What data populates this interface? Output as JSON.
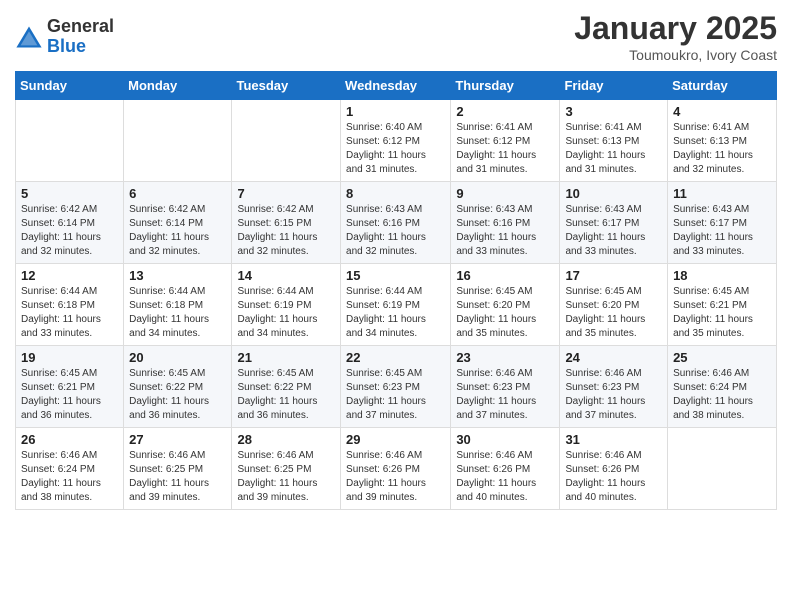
{
  "logo": {
    "general": "General",
    "blue": "Blue"
  },
  "title": {
    "month_year": "January 2025",
    "location": "Toumoukro, Ivory Coast"
  },
  "days_of_week": [
    "Sunday",
    "Monday",
    "Tuesday",
    "Wednesday",
    "Thursday",
    "Friday",
    "Saturday"
  ],
  "weeks": [
    [
      {
        "day": "",
        "info": ""
      },
      {
        "day": "",
        "info": ""
      },
      {
        "day": "",
        "info": ""
      },
      {
        "day": "1",
        "info": "Sunrise: 6:40 AM\nSunset: 6:12 PM\nDaylight: 11 hours and 31 minutes."
      },
      {
        "day": "2",
        "info": "Sunrise: 6:41 AM\nSunset: 6:12 PM\nDaylight: 11 hours and 31 minutes."
      },
      {
        "day": "3",
        "info": "Sunrise: 6:41 AM\nSunset: 6:13 PM\nDaylight: 11 hours and 31 minutes."
      },
      {
        "day": "4",
        "info": "Sunrise: 6:41 AM\nSunset: 6:13 PM\nDaylight: 11 hours and 32 minutes."
      }
    ],
    [
      {
        "day": "5",
        "info": "Sunrise: 6:42 AM\nSunset: 6:14 PM\nDaylight: 11 hours and 32 minutes."
      },
      {
        "day": "6",
        "info": "Sunrise: 6:42 AM\nSunset: 6:14 PM\nDaylight: 11 hours and 32 minutes."
      },
      {
        "day": "7",
        "info": "Sunrise: 6:42 AM\nSunset: 6:15 PM\nDaylight: 11 hours and 32 minutes."
      },
      {
        "day": "8",
        "info": "Sunrise: 6:43 AM\nSunset: 6:16 PM\nDaylight: 11 hours and 32 minutes."
      },
      {
        "day": "9",
        "info": "Sunrise: 6:43 AM\nSunset: 6:16 PM\nDaylight: 11 hours and 33 minutes."
      },
      {
        "day": "10",
        "info": "Sunrise: 6:43 AM\nSunset: 6:17 PM\nDaylight: 11 hours and 33 minutes."
      },
      {
        "day": "11",
        "info": "Sunrise: 6:43 AM\nSunset: 6:17 PM\nDaylight: 11 hours and 33 minutes."
      }
    ],
    [
      {
        "day": "12",
        "info": "Sunrise: 6:44 AM\nSunset: 6:18 PM\nDaylight: 11 hours and 33 minutes."
      },
      {
        "day": "13",
        "info": "Sunrise: 6:44 AM\nSunset: 6:18 PM\nDaylight: 11 hours and 34 minutes."
      },
      {
        "day": "14",
        "info": "Sunrise: 6:44 AM\nSunset: 6:19 PM\nDaylight: 11 hours and 34 minutes."
      },
      {
        "day": "15",
        "info": "Sunrise: 6:44 AM\nSunset: 6:19 PM\nDaylight: 11 hours and 34 minutes."
      },
      {
        "day": "16",
        "info": "Sunrise: 6:45 AM\nSunset: 6:20 PM\nDaylight: 11 hours and 35 minutes."
      },
      {
        "day": "17",
        "info": "Sunrise: 6:45 AM\nSunset: 6:20 PM\nDaylight: 11 hours and 35 minutes."
      },
      {
        "day": "18",
        "info": "Sunrise: 6:45 AM\nSunset: 6:21 PM\nDaylight: 11 hours and 35 minutes."
      }
    ],
    [
      {
        "day": "19",
        "info": "Sunrise: 6:45 AM\nSunset: 6:21 PM\nDaylight: 11 hours and 36 minutes."
      },
      {
        "day": "20",
        "info": "Sunrise: 6:45 AM\nSunset: 6:22 PM\nDaylight: 11 hours and 36 minutes."
      },
      {
        "day": "21",
        "info": "Sunrise: 6:45 AM\nSunset: 6:22 PM\nDaylight: 11 hours and 36 minutes."
      },
      {
        "day": "22",
        "info": "Sunrise: 6:45 AM\nSunset: 6:23 PM\nDaylight: 11 hours and 37 minutes."
      },
      {
        "day": "23",
        "info": "Sunrise: 6:46 AM\nSunset: 6:23 PM\nDaylight: 11 hours and 37 minutes."
      },
      {
        "day": "24",
        "info": "Sunrise: 6:46 AM\nSunset: 6:23 PM\nDaylight: 11 hours and 37 minutes."
      },
      {
        "day": "25",
        "info": "Sunrise: 6:46 AM\nSunset: 6:24 PM\nDaylight: 11 hours and 38 minutes."
      }
    ],
    [
      {
        "day": "26",
        "info": "Sunrise: 6:46 AM\nSunset: 6:24 PM\nDaylight: 11 hours and 38 minutes."
      },
      {
        "day": "27",
        "info": "Sunrise: 6:46 AM\nSunset: 6:25 PM\nDaylight: 11 hours and 39 minutes."
      },
      {
        "day": "28",
        "info": "Sunrise: 6:46 AM\nSunset: 6:25 PM\nDaylight: 11 hours and 39 minutes."
      },
      {
        "day": "29",
        "info": "Sunrise: 6:46 AM\nSunset: 6:26 PM\nDaylight: 11 hours and 39 minutes."
      },
      {
        "day": "30",
        "info": "Sunrise: 6:46 AM\nSunset: 6:26 PM\nDaylight: 11 hours and 40 minutes."
      },
      {
        "day": "31",
        "info": "Sunrise: 6:46 AM\nSunset: 6:26 PM\nDaylight: 11 hours and 40 minutes."
      },
      {
        "day": "",
        "info": ""
      }
    ]
  ]
}
